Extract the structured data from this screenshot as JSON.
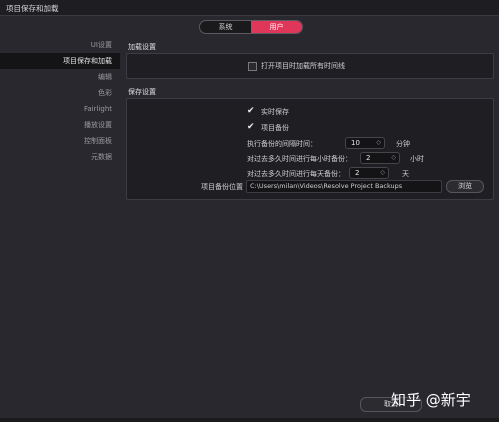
{
  "window": {
    "title": "项目保存和加载"
  },
  "tabs": {
    "system": "系统",
    "user": "用户",
    "active": "用户"
  },
  "sidebar": {
    "items": [
      {
        "label": "UI设置"
      },
      {
        "label": "项目保存和加载"
      },
      {
        "label": "编辑"
      },
      {
        "label": "色彩"
      },
      {
        "label": "Fairlight"
      },
      {
        "label": "播放设置"
      },
      {
        "label": "控制面板"
      },
      {
        "label": "元数据"
      }
    ],
    "active_index": 1
  },
  "load_settings": {
    "title": "加载设置",
    "load_all_timelines": {
      "label": "打开项目时加载所有时间线",
      "checked": false
    }
  },
  "save_settings": {
    "title": "保存设置",
    "live_save": {
      "label": "实时保存",
      "checked": true
    },
    "project_backups": {
      "label": "项目备份",
      "checked": true
    },
    "backup_interval": {
      "label": "执行备份的间隔时间：",
      "value": "10",
      "unit": "分钟"
    },
    "hourly_backups": {
      "label": "对过去多久时间进行每小时备份：",
      "value": "2",
      "unit": "小时"
    },
    "daily_backups": {
      "label": "对过去多久时间进行每天备份：",
      "value": "2",
      "unit": "天"
    },
    "backup_location": {
      "label": "项目备份位置",
      "value": "C:\\Users\\milan\\Videos\\Resolve Project Backups",
      "browse_label": "浏览"
    }
  },
  "footer": {
    "cancel_label": "取消"
  },
  "watermark": "知乎 @新宇"
}
